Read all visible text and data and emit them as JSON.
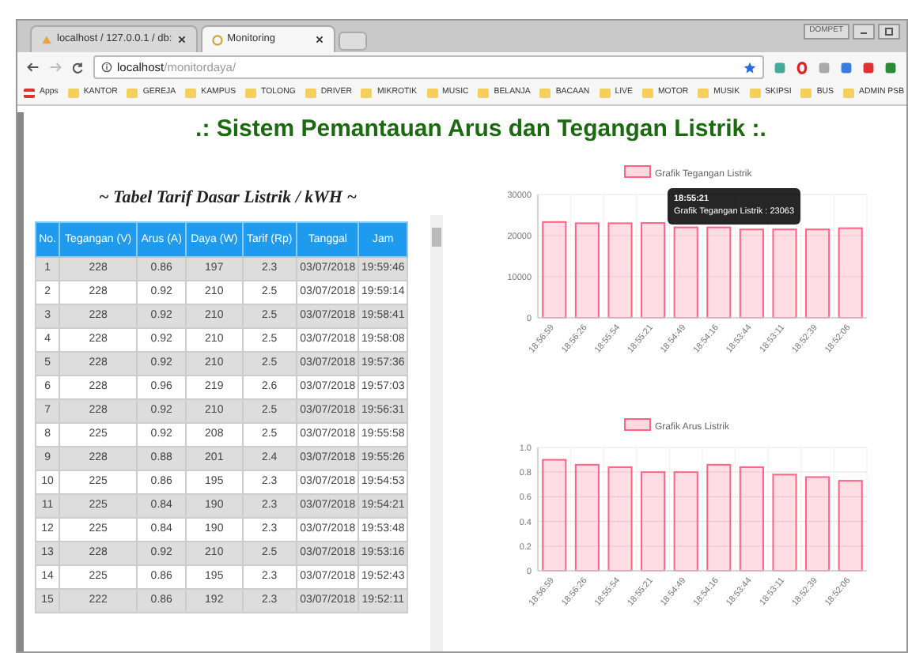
{
  "browser": {
    "tabs": [
      {
        "label": "localhost / 127.0.0.1 / db:",
        "selected": false
      },
      {
        "label": "Monitoring",
        "selected": true
      }
    ],
    "window_button": "DOMPET",
    "address": {
      "host": "localhost",
      "path": "/monitordaya/"
    },
    "bookmarks": [
      "Apps",
      "KANTOR",
      "GEREJA",
      "KAMPUS",
      "TOLONG",
      "DRIVER",
      "MIKROTIK",
      "MUSIC",
      "BELANJA",
      "BACAAN",
      "LIVE",
      "MOTOR",
      "MUSIK",
      "SKIPSI",
      "BUS",
      "ADMIN PSB"
    ]
  },
  "page_title": ".: Sistem Pemantauan Arus dan Tegangan Listrik :.",
  "table": {
    "title": "~ Tabel Tarif Dasar Listrik / kWH ~",
    "columns": [
      "No.",
      "Tegangan (V)",
      "Arus (A)",
      "Daya (W)",
      "Tarif (Rp)",
      "Tanggal",
      "Jam"
    ],
    "rows": [
      [
        "1",
        "228",
        "0.86",
        "197",
        "2.3",
        "03/07/2018",
        "19:59:46"
      ],
      [
        "2",
        "228",
        "0.92",
        "210",
        "2.5",
        "03/07/2018",
        "19:59:14"
      ],
      [
        "3",
        "228",
        "0.92",
        "210",
        "2.5",
        "03/07/2018",
        "19:58:41"
      ],
      [
        "4",
        "228",
        "0.92",
        "210",
        "2.5",
        "03/07/2018",
        "19:58:08"
      ],
      [
        "5",
        "228",
        "0.92",
        "210",
        "2.5",
        "03/07/2018",
        "19:57:36"
      ],
      [
        "6",
        "228",
        "0.96",
        "219",
        "2.6",
        "03/07/2018",
        "19:57:03"
      ],
      [
        "7",
        "228",
        "0.92",
        "210",
        "2.5",
        "03/07/2018",
        "19:56:31"
      ],
      [
        "8",
        "225",
        "0.92",
        "208",
        "2.5",
        "03/07/2018",
        "19:55:58"
      ],
      [
        "9",
        "228",
        "0.88",
        "201",
        "2.4",
        "03/07/2018",
        "19:55:26"
      ],
      [
        "10",
        "225",
        "0.86",
        "195",
        "2.3",
        "03/07/2018",
        "19:54:53"
      ],
      [
        "11",
        "225",
        "0.84",
        "190",
        "2.3",
        "03/07/2018",
        "19:54:21"
      ],
      [
        "12",
        "225",
        "0.84",
        "190",
        "2.3",
        "03/07/2018",
        "19:53:48"
      ],
      [
        "13",
        "228",
        "0.92",
        "210",
        "2.5",
        "03/07/2018",
        "19:53:16"
      ],
      [
        "14",
        "225",
        "0.86",
        "195",
        "2.3",
        "03/07/2018",
        "19:52:43"
      ],
      [
        "15",
        "222",
        "0.86",
        "192",
        "2.3",
        "03/07/2018",
        "19:52:11"
      ]
    ]
  },
  "charts": [
    {
      "tooltip": {
        "title": "18:55:21",
        "text": "Grafik Tegangan Listrik : 23063"
      },
      "chart_data": {
        "type": "bar",
        "categories": [
          "18:56:59",
          "18:56:26",
          "18:55:54",
          "18:55:21",
          "18:54:49",
          "18:54:16",
          "18:53:44",
          "18:53:11",
          "18:52:39",
          "18:52:06"
        ],
        "series": [
          {
            "name": "Grafik Tegangan Listrik",
            "color": "#ff6384",
            "values": [
              23300,
              23000,
              23000,
              23063,
              22000,
              22000,
              21500,
              21500,
              21500,
              21800
            ]
          }
        ],
        "ylim": [
          0,
          30000
        ],
        "yticks": [
          0,
          10000,
          20000,
          30000
        ],
        "grid": true
      }
    },
    {
      "chart_data": {
        "type": "bar",
        "categories": [
          "18:56:59",
          "18:56:26",
          "18:55:54",
          "18:55:21",
          "18:54:49",
          "18:54:16",
          "18:53:44",
          "18:53:11",
          "18:52:39",
          "18:52:06"
        ],
        "series": [
          {
            "name": "Grafik Arus Listrik",
            "color": "#ff6384",
            "values": [
              0.9,
              0.86,
              0.84,
              0.8,
              0.8,
              0.86,
              0.84,
              0.78,
              0.76,
              0.73
            ]
          }
        ],
        "ylim": [
          0,
          1
        ],
        "yticks": [
          {
            "value": 0,
            "label": "0"
          },
          {
            "value": 0.2,
            "label": "0.2"
          },
          {
            "value": 0.4,
            "label": "0.4"
          },
          {
            "value": 0.6,
            "label": "0.6"
          },
          {
            "value": 0.8,
            "label": "0.8"
          },
          {
            "value": 1,
            "label": "1.0"
          }
        ],
        "grid": true
      }
    }
  ]
}
